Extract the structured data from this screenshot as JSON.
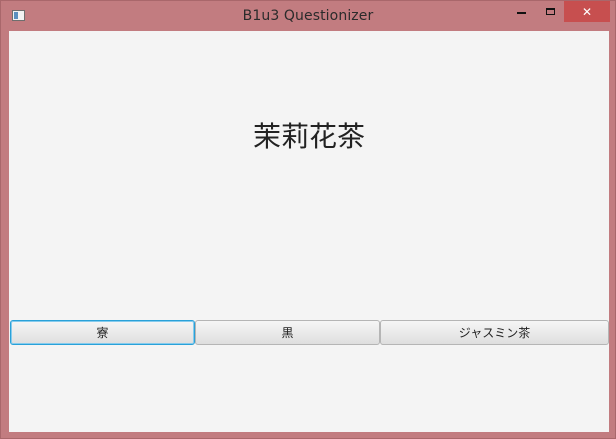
{
  "window": {
    "title": "B1u3 Questionizer",
    "app_icon": "app-window-icon",
    "controls": {
      "minimize_icon": "minimize-icon",
      "maximize_icon": "maximize-icon",
      "close_icon": "close-icon",
      "close_glyph": "✕"
    }
  },
  "question": {
    "text": "茉莉花茶"
  },
  "answers": [
    {
      "label": "寮",
      "focused": true
    },
    {
      "label": "黒",
      "focused": false
    },
    {
      "label": "ジャスミン茶",
      "focused": false
    }
  ],
  "colors": {
    "frame": "#c27c80",
    "client_bg": "#f4f4f4",
    "close_button": "#c74f4f",
    "focus_ring": "#2aa1d8"
  }
}
